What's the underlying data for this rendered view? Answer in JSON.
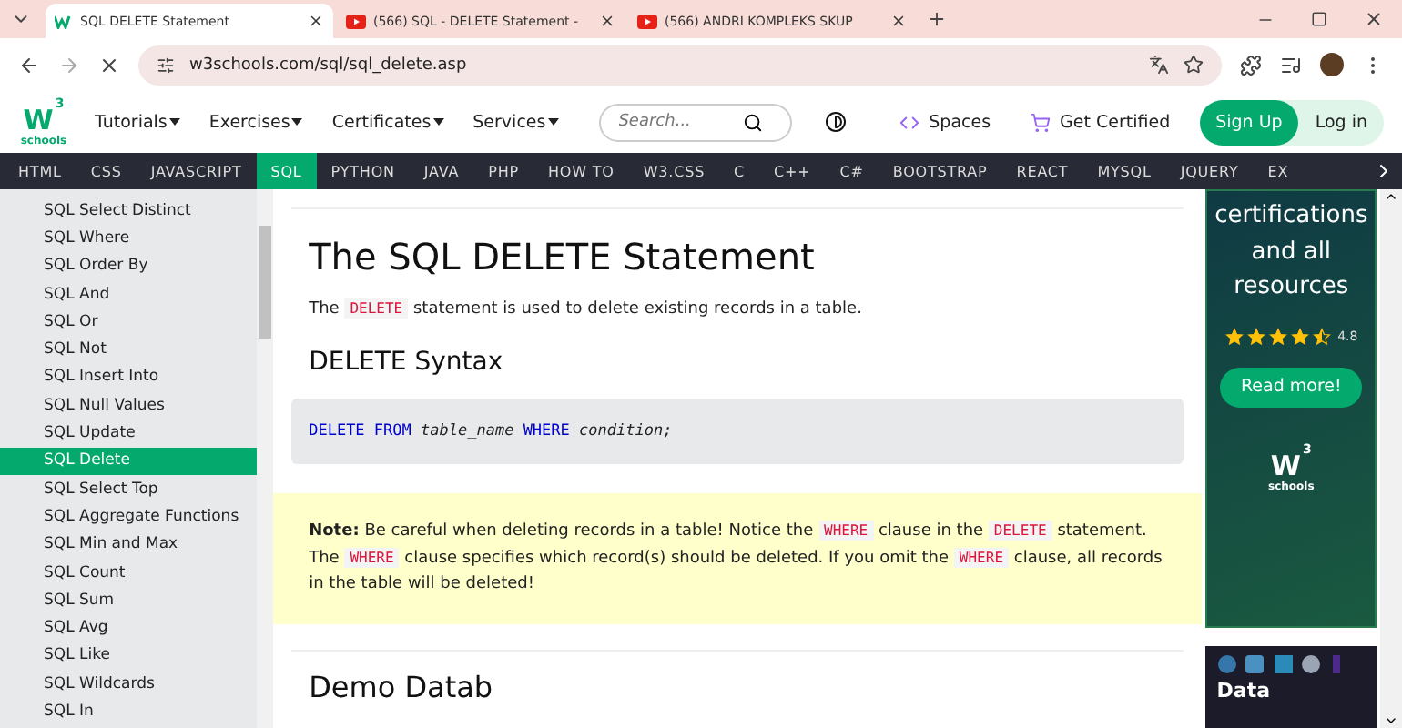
{
  "browser": {
    "tabs": [
      {
        "title": "SQL DELETE Statement",
        "selected": true,
        "kind": "site"
      },
      {
        "title": "(566) SQL - DELETE Statement -",
        "selected": false,
        "kind": "video"
      },
      {
        "title": "(566) ANDRI KOMPLEKS SKUP",
        "selected": false,
        "kind": "video"
      }
    ],
    "url": "w3schools.com/sql/sql_delete.asp"
  },
  "header": {
    "logo_mark": "W",
    "logo_sup": "3",
    "logo_text": "schools",
    "menus": [
      "Tutorials",
      "Exercises",
      "Certificates",
      "Services"
    ],
    "search": {
      "placeholder": "Search..."
    },
    "spaces": "Spaces",
    "get_certified": "Get Certified",
    "sign_up": "Sign Up",
    "log_in": "Log in"
  },
  "nav": [
    {
      "label": "HTML",
      "selected": false
    },
    {
      "label": "CSS",
      "selected": false
    },
    {
      "label": "JAVASCRIPT",
      "selected": false
    },
    {
      "label": "SQL",
      "selected": true
    },
    {
      "label": "PYTHON",
      "selected": false
    },
    {
      "label": "JAVA",
      "selected": false
    },
    {
      "label": "PHP",
      "selected": false
    },
    {
      "label": "HOW TO",
      "selected": false
    },
    {
      "label": "W3.CSS",
      "selected": false
    },
    {
      "label": "C",
      "selected": false
    },
    {
      "label": "C++",
      "selected": false
    },
    {
      "label": "C#",
      "selected": false
    },
    {
      "label": "BOOTSTRAP",
      "selected": false
    },
    {
      "label": "REACT",
      "selected": false
    },
    {
      "label": "MYSQL",
      "selected": false
    },
    {
      "label": "JQUERY",
      "selected": false
    },
    {
      "label": "EX",
      "selected": false
    }
  ],
  "sidebar": {
    "items": [
      {
        "label": "SQL Select Distinct",
        "selected": false
      },
      {
        "label": "SQL Where",
        "selected": false
      },
      {
        "label": "SQL Order By",
        "selected": false
      },
      {
        "label": "SQL And",
        "selected": false
      },
      {
        "label": "SQL Or",
        "selected": false
      },
      {
        "label": "SQL Not",
        "selected": false
      },
      {
        "label": "SQL Insert Into",
        "selected": false
      },
      {
        "label": "SQL Null Values",
        "selected": false
      },
      {
        "label": "SQL Update",
        "selected": false
      },
      {
        "label": "SQL Delete",
        "selected": true
      },
      {
        "label": "SQL Select Top",
        "selected": false
      },
      {
        "label": "SQL Aggregate Functions",
        "selected": false
      },
      {
        "label": "SQL Min and Max",
        "selected": false
      },
      {
        "label": "SQL Count",
        "selected": false
      },
      {
        "label": "SQL Sum",
        "selected": false
      },
      {
        "label": "SQL Avg",
        "selected": false
      },
      {
        "label": "SQL Like",
        "selected": false
      },
      {
        "label": "SQL Wildcards",
        "selected": false
      },
      {
        "label": "SQL In",
        "selected": false
      }
    ]
  },
  "content": {
    "title": "The SQL DELETE Statement",
    "intro": [
      {
        "kind": "text",
        "text": "The "
      },
      {
        "kind": "code",
        "text": "DELETE"
      },
      {
        "kind": "text",
        "text": " statement is used to delete existing records in a table."
      }
    ],
    "syntax_title": "DELETE Syntax",
    "syntax": [
      {
        "kind": "keyword",
        "text": "DELETE FROM"
      },
      {
        "kind": "var",
        "text": " table_name "
      },
      {
        "kind": "keyword",
        "text": "WHERE"
      },
      {
        "kind": "var",
        "text": " condition;"
      }
    ],
    "note": [
      {
        "kind": "bold",
        "text": "Note:"
      },
      {
        "kind": "text",
        "text": " Be careful when deleting records in a table! Notice the "
      },
      {
        "kind": "code",
        "text": "WHERE"
      },
      {
        "kind": "text",
        "text": " clause in the "
      },
      {
        "kind": "code",
        "text": "DELETE"
      },
      {
        "kind": "text",
        "text": " statement. The "
      },
      {
        "kind": "code",
        "text": "WHERE"
      },
      {
        "kind": "text",
        "text": " clause specifies which record(s) should be deleted. If you omit the "
      },
      {
        "kind": "code",
        "text": "WHERE"
      },
      {
        "kind": "text",
        "text": " clause, all records in the table will be deleted!"
      }
    ],
    "next_title": "Demo Datab"
  },
  "ad": {
    "text": "certifications and all resources",
    "stars": 4.5,
    "rating": "4.8",
    "button": "Read more!",
    "logo_mark": "W",
    "logo_sup": "3",
    "logo_text": "schools"
  },
  "ad2": {
    "title": "Data"
  }
}
